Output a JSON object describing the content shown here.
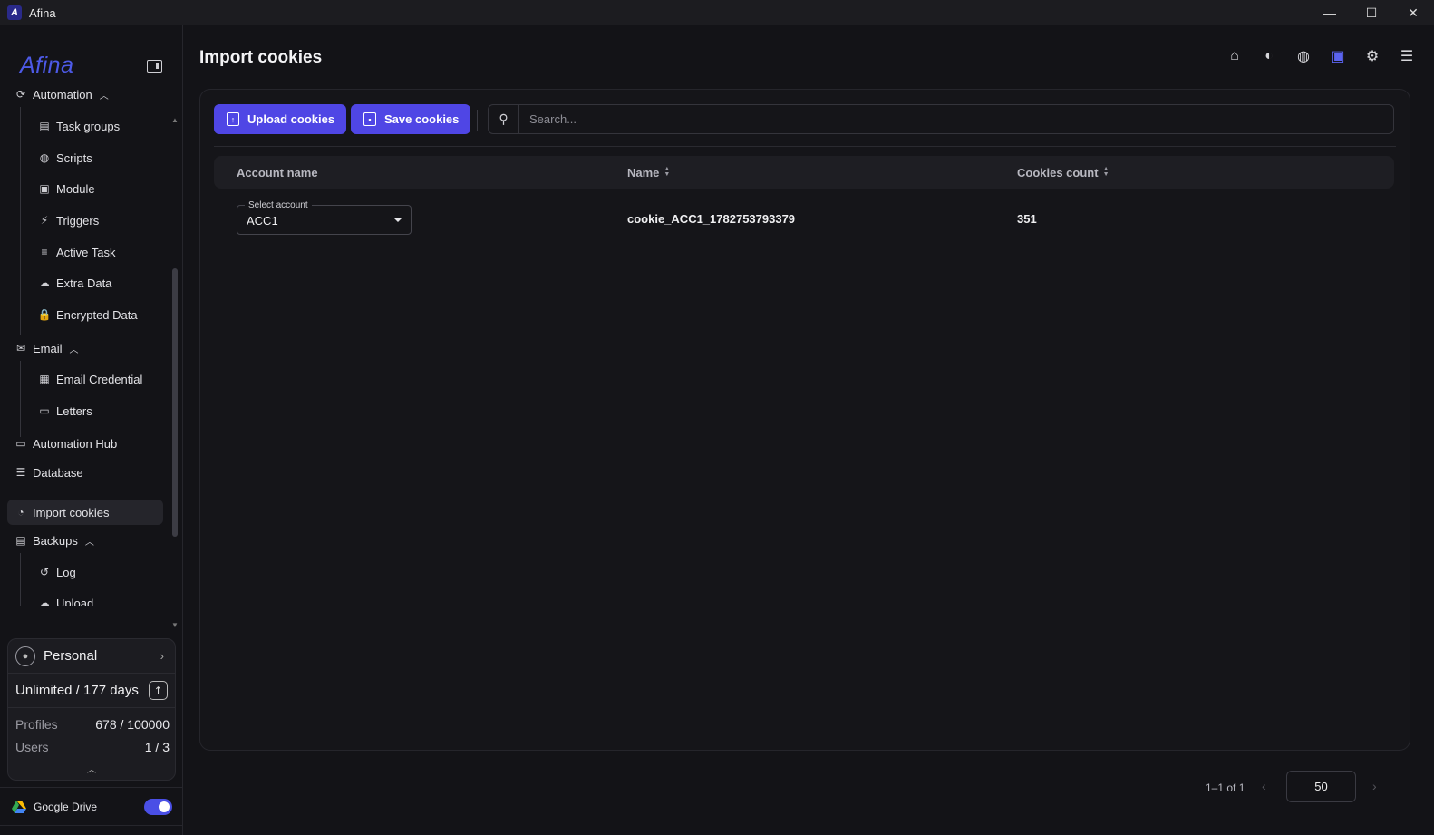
{
  "window": {
    "title": "Afina",
    "logo_letter": "A",
    "minimize": "—",
    "maximize": "☐",
    "close": "✕"
  },
  "sidebar": {
    "brand": "Afina",
    "nav": [
      {
        "label": "Automation",
        "icon": "automation-icon",
        "glyph": "⟳",
        "expanded": true
      },
      {
        "label": "Task groups",
        "icon": "task-groups-icon",
        "glyph": "▤"
      },
      {
        "label": "Scripts",
        "icon": "github-icon",
        "glyph": "◍"
      },
      {
        "label": "Module",
        "icon": "module-icon",
        "glyph": "▣"
      },
      {
        "label": "Triggers",
        "icon": "lightning-icon",
        "glyph": "⚡"
      },
      {
        "label": "Active Task",
        "icon": "playlist-icon",
        "glyph": "≡"
      },
      {
        "label": "Extra Data",
        "icon": "cloud-icon",
        "glyph": "☁"
      },
      {
        "label": "Encrypted Data",
        "icon": "lock-icon",
        "glyph": "🔒"
      },
      {
        "label": "Email",
        "icon": "mail-icon",
        "glyph": "✉",
        "expanded": true
      },
      {
        "label": "Email Credential",
        "icon": "contact-card-icon",
        "glyph": "▦"
      },
      {
        "label": "Letters",
        "icon": "inbox-icon",
        "glyph": "▭"
      },
      {
        "label": "Automation Hub",
        "icon": "laptop-icon",
        "glyph": "▭"
      },
      {
        "label": "Database",
        "icon": "database-list-icon",
        "glyph": "☰"
      },
      {
        "label": "Import cookies",
        "icon": "cookie-icon",
        "glyph": "◔",
        "active": true
      },
      {
        "label": "Backups",
        "icon": "backups-icon",
        "glyph": "▤",
        "expanded": true
      },
      {
        "label": "Log",
        "icon": "history-icon",
        "glyph": "↺"
      },
      {
        "label": "Upload",
        "icon": "cloud-upload-icon",
        "glyph": "☁"
      }
    ],
    "plan": {
      "name": "Personal",
      "limit": "Unlimited / 177 days",
      "profiles_label": "Profiles",
      "profiles_value": "678 / 100000",
      "users_label": "Users",
      "users_value": "1 / 3"
    },
    "google_drive": {
      "label": "Google Drive",
      "enabled": true
    }
  },
  "main": {
    "title": "Import cookies",
    "upload_button": "Upload cookies",
    "save_button": "Save cookies",
    "search_placeholder": "Search...",
    "columns": [
      "Account name",
      "Name",
      "Cookies count"
    ],
    "rows": [
      {
        "select_label": "Select account",
        "account": "ACC1",
        "name": "cookie_ACC1_1782753793379",
        "count": "351"
      }
    ],
    "pagination": {
      "info": "1–1 of 1",
      "page_size": "50"
    }
  },
  "colors": {
    "accent": "#4f46e5",
    "background": "#131317",
    "panel": "#151519"
  }
}
